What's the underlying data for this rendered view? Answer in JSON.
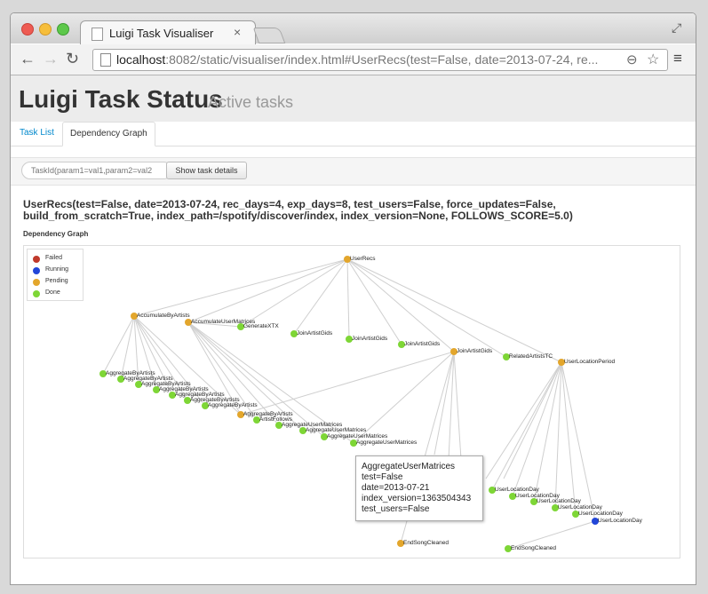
{
  "browser": {
    "tab_title": "Luigi Task Visualiser",
    "tab_close": "×",
    "url_host": "localhost",
    "url_rest": ":8082/static/visualiser/index.html#UserRecs(test=False, date=2013-07-24, re..."
  },
  "header": {
    "title": "Luigi Task Status",
    "subtitle": "Active tasks"
  },
  "nav_tabs": [
    {
      "label": "Task List"
    },
    {
      "label": "Dependency Graph"
    }
  ],
  "search": {
    "placeholder": "TaskId(param1=val1,param2=val2",
    "button_label": "Show task details"
  },
  "task": {
    "title": "UserRecs(test=False, date=2013-07-24, rec_days=4, exp_days=8, test_users=False, force_updates=False, build_from_scratch=True, index_path=/spotify/discover/index, index_version=None, FOLLOWS_SCORE=5.0)",
    "graph_label": "Dependency Graph"
  },
  "legend": [
    {
      "label": "Failed",
      "color": "#c0392b"
    },
    {
      "label": "Running",
      "color": "#2246d8"
    },
    {
      "label": "Pending",
      "color": "#e3a62c"
    },
    {
      "label": "Done",
      "color": "#7ed636"
    }
  ],
  "graph": {
    "status_colors": {
      "failed": "#c0392b",
      "running": "#2246d8",
      "pending": "#e3a62c",
      "done": "#7ed636"
    },
    "nodes": [
      {
        "id": "n0",
        "label": "UserRecs",
        "status": "pending"
      },
      {
        "id": "n1",
        "label": "AccumulateByArtists",
        "status": "pending"
      },
      {
        "id": "n2",
        "label": "AccumulateUserMatrices",
        "status": "pending"
      },
      {
        "id": "n3",
        "label": "GenerateXTX",
        "status": "done"
      },
      {
        "id": "n4",
        "label": "JoinArtistGids",
        "status": "done"
      },
      {
        "id": "n5",
        "label": "JoinArtistGids",
        "status": "done"
      },
      {
        "id": "n6",
        "label": "JoinArtistGids",
        "status": "done"
      },
      {
        "id": "n7",
        "label": "JoinArtistGids",
        "status": "pending"
      },
      {
        "id": "n8",
        "label": "RelatedArtistsTC",
        "status": "done"
      },
      {
        "id": "n9",
        "label": "UserLocationPeriod",
        "status": "pending"
      },
      {
        "id": "a1",
        "label": "AggregateByArtists",
        "status": "done"
      },
      {
        "id": "a2",
        "label": "AggregateByArtists",
        "status": "done"
      },
      {
        "id": "a3",
        "label": "AggregateByArtists",
        "status": "done"
      },
      {
        "id": "a4",
        "label": "AggregateByArtists",
        "status": "done"
      },
      {
        "id": "a5",
        "label": "AggregateByArtists",
        "status": "done"
      },
      {
        "id": "a6",
        "label": "AggregateByArtists",
        "status": "done"
      },
      {
        "id": "a7",
        "label": "AggregateByArtists",
        "status": "done"
      },
      {
        "id": "a8",
        "label": "AggregateByArtists",
        "status": "pending"
      },
      {
        "id": "af",
        "label": "ArtistFollows",
        "status": "done"
      },
      {
        "id": "u1",
        "label": "AggregateUserMatrices",
        "status": "done"
      },
      {
        "id": "u2",
        "label": "AggregateUserMatrices",
        "status": "done"
      },
      {
        "id": "u3",
        "label": "AggregateUserMatrices",
        "status": "done"
      },
      {
        "id": "u4",
        "label": "AggregateUserMatrices",
        "status": "done"
      },
      {
        "id": "l0",
        "label": "UserLocationDay",
        "status": "done"
      },
      {
        "id": "l1",
        "label": "UserLocationDay",
        "status": "done"
      },
      {
        "id": "l2",
        "label": "UserLocationDay",
        "status": "done"
      },
      {
        "id": "l3",
        "label": "UserLocationDay",
        "status": "done"
      },
      {
        "id": "l4",
        "label": "UserLocationDay",
        "status": "done"
      },
      {
        "id": "l5",
        "label": "UserLocationDay",
        "status": "running"
      },
      {
        "id": "e1",
        "label": "EndSongCleaned",
        "status": "pending"
      },
      {
        "id": "e2",
        "label": "EndSongCleaned",
        "status": "done"
      }
    ]
  },
  "tooltip": {
    "lines": [
      "AggregateUserMatrices",
      "test=False",
      "date=2013-07-21",
      "index_version=1363504343",
      "test_users=False"
    ]
  }
}
